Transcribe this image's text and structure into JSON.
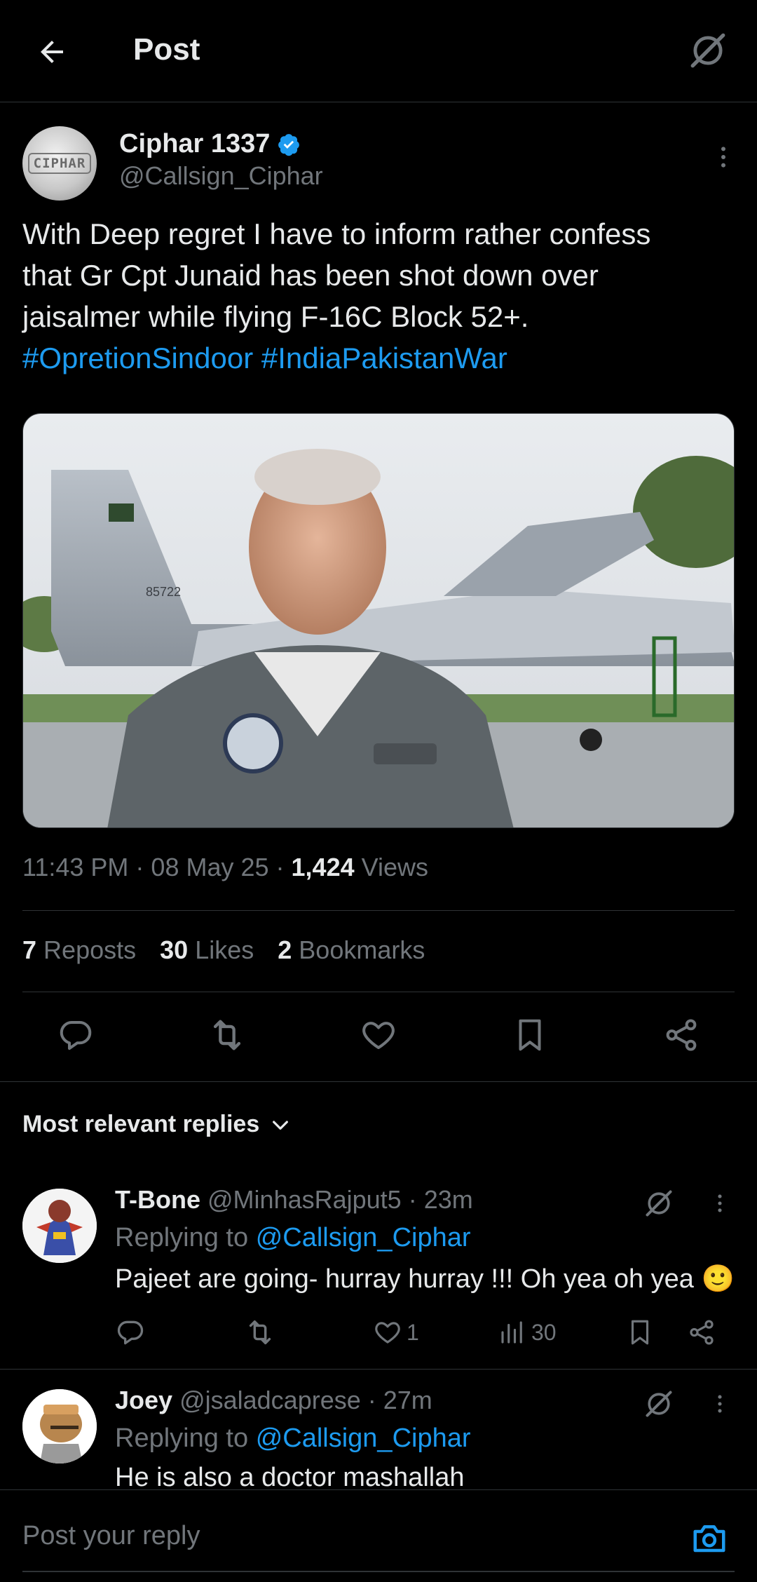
{
  "header": {
    "title": "Post"
  },
  "post": {
    "author_name": "Ciphar 1337",
    "author_handle": "@Callsign_Ciphar",
    "avatar_text": "CIPHAR",
    "text_lines": [
      "With Deep regret I have to inform rather confess",
      "that Gr Cpt Junaid has been shot down over",
      "jaisalmer while flying F-16C Block 52+."
    ],
    "hashtags": [
      "#OpretionSindoor",
      "#IndiaPakistanWar"
    ],
    "image_tail_number": "85722",
    "time": "11:43 PM",
    "date": "08 May 25",
    "views_count": "1,424",
    "views_label": "Views",
    "reposts_count": "7",
    "reposts_label": "Reposts",
    "likes_count": "30",
    "likes_label": "Likes",
    "bookmarks_count": "2",
    "bookmarks_label": "Bookmarks"
  },
  "replies_section": {
    "label": "Most relevant replies"
  },
  "replies": [
    {
      "name": "T-Bone",
      "handle": "@MinhasRajput5",
      "time": "23m",
      "replying_prefix": "Replying to",
      "replying_to": "@Callsign_Ciphar",
      "text": "Pajeet are going- hurray hurray !!! Oh yea oh yea",
      "emoji": "🙂",
      "likes": "1",
      "views": "30"
    },
    {
      "name": "Joey",
      "handle": "@jsaladcaprese",
      "time": "27m",
      "replying_prefix": "Replying to",
      "replying_to": "@Callsign_Ciphar",
      "text": "He is also a doctor mashallah"
    }
  ],
  "composer": {
    "placeholder": "Post your reply"
  },
  "colors": {
    "background": "#000000",
    "text": "#e7e9ea",
    "muted": "#71767b",
    "accent": "#1d9bf0",
    "verified": "#1d9bf0",
    "divider": "#2f3336"
  }
}
